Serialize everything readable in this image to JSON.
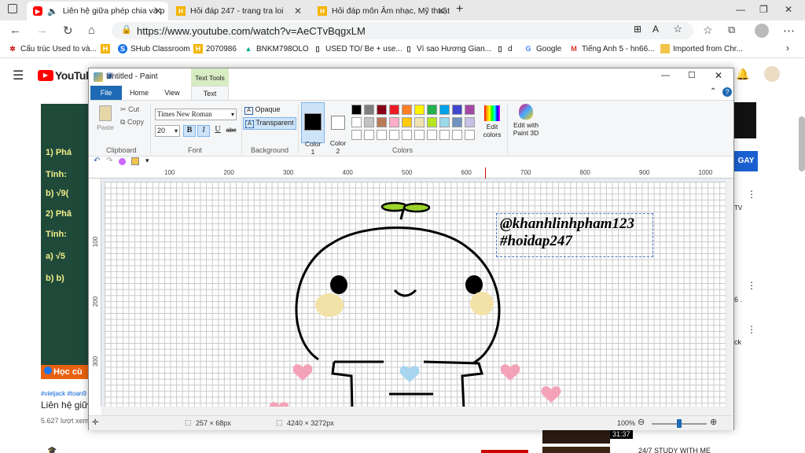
{
  "browser": {
    "tabs": [
      {
        "title": "Liên hệ giữa phép chia và p"
      },
      {
        "title": "Hỏi đáp 247 - trang tra loi"
      },
      {
        "title": "Hỏi đáp môn Âm nhạc, Mỹ thuật"
      }
    ],
    "url": "https://www.youtube.com/watch?v=AeCTvBqgxLM",
    "bookmarks": [
      "Cấu trúc Used to và...",
      "SHub Classroom",
      "2070986",
      "BNKM798OLO",
      "USED TO/ Be + use...",
      "Vì sao Hương Gian...",
      "d",
      "Google",
      "Tiếng Anh 5 - hn66...",
      "Imported from Chr..."
    ]
  },
  "youtube": {
    "logo": "YouTube",
    "subscribe": "GAY",
    "video_title": "Liên hệ giữa",
    "tags": "#vietjack #toan9",
    "views": "5.627 lượt xem",
    "board_lines": [
      "1)  Phá",
      "Tính:",
      "b) √9(",
      "2)  Phâ",
      "Tính:",
      "a) √5",
      "b)  b)"
    ],
    "banner": "Học cù",
    "duration": "31:37",
    "suggest_title": "24/7 STUDY WITH ME",
    "side_fragments": [
      "TV",
      "6 .",
      "ck"
    ]
  },
  "paint": {
    "title": "Untitled - Paint",
    "tabs": {
      "file": "File",
      "home": "Home",
      "view": "View",
      "text": "Text",
      "text_tools": "Text Tools"
    },
    "clipboard": {
      "paste": "Paste",
      "cut": "Cut",
      "copy": "Copy",
      "label": "Clipboard"
    },
    "font": {
      "family": "Times New Roman",
      "size": "20",
      "bold": "B",
      "italic": "I",
      "underline": "U",
      "strike": "abc",
      "label": "Font"
    },
    "background": {
      "opaque": "Opaque",
      "transparent": "Transparent",
      "label": "Background"
    },
    "colors": {
      "color1": "Color\n1",
      "color2": "Color\n2",
      "edit": "Edit colors",
      "paint3d": "Edit with Paint 3D",
      "label": "Colors",
      "row1": [
        "#000000",
        "#7f7f7f",
        "#880015",
        "#ed1c24",
        "#ff7f27",
        "#fff200",
        "#22b14c",
        "#00a2e8",
        "#3f48cc",
        "#a349a4"
      ],
      "row2": [
        "#ffffff",
        "#c3c3c3",
        "#b97a57",
        "#ffaec9",
        "#ffc90e",
        "#efe4b0",
        "#b5e61d",
        "#99d9ea",
        "#7092be",
        "#c8bfe7"
      ]
    },
    "ruler_h": [
      "100",
      "200",
      "300",
      "400",
      "500",
      "600",
      "700",
      "800",
      "900",
      "1000"
    ],
    "ruler_v": [
      "100",
      "200",
      "300"
    ],
    "text_lines": [
      "@khanhlinhpham123",
      "#hoidap247"
    ],
    "status": {
      "selection": "257 × 68px",
      "size": "4240 × 3272px",
      "zoom": "100%"
    }
  }
}
